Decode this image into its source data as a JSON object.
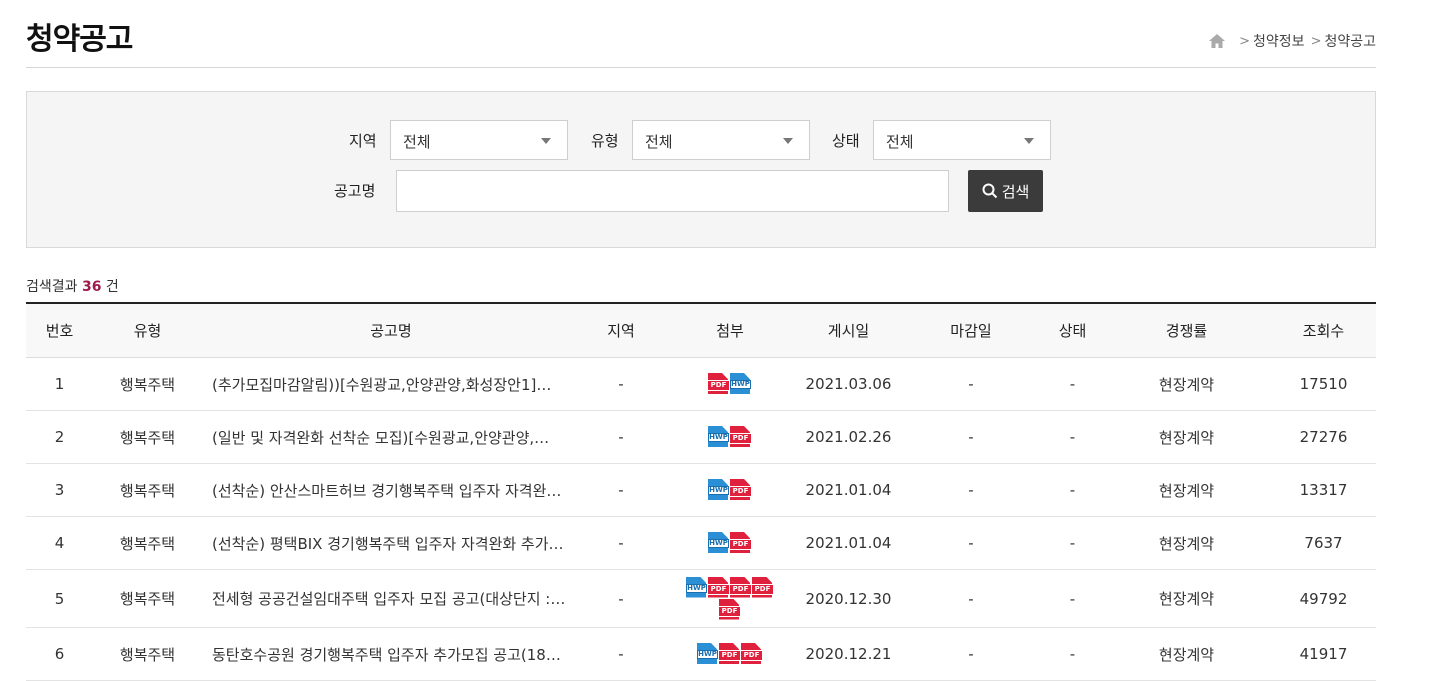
{
  "header": {
    "title": "청약공고",
    "breadcrumb": [
      "청약정보",
      "청약공고"
    ]
  },
  "search": {
    "region_label": "지역",
    "region_value": "전체",
    "type_label": "유형",
    "type_value": "전체",
    "status_label": "상태",
    "status_value": "전체",
    "keyword_label": "공고명",
    "keyword_value": "",
    "button_label": "검색"
  },
  "result": {
    "prefix": "검색결과",
    "count": "36",
    "suffix": "건"
  },
  "table": {
    "headers": [
      "번호",
      "유형",
      "공고명",
      "지역",
      "첨부",
      "게시일",
      "마감일",
      "상태",
      "경쟁률",
      "조회수"
    ],
    "rows": [
      {
        "no": "1",
        "type": "행복주택",
        "title": "(추가모집마감알림))[수원광교,안양관양,화성장안1]…",
        "region": "-",
        "files": [
          "pdf",
          "hwp"
        ],
        "posted": "2021.03.06",
        "deadline": "-",
        "status": "-",
        "rate": "현장계약",
        "views": "17510"
      },
      {
        "no": "2",
        "type": "행복주택",
        "title": "(일반 및 자격완화 선착순 모집)[수원광교,안양관양,…",
        "region": "-",
        "files": [
          "hwp",
          "pdf"
        ],
        "posted": "2021.02.26",
        "deadline": "-",
        "status": "-",
        "rate": "현장계약",
        "views": "27276"
      },
      {
        "no": "3",
        "type": "행복주택",
        "title": "(선착순) 안산스마트허브 경기행복주택 입주자 자격완…",
        "region": "-",
        "files": [
          "hwp",
          "pdf"
        ],
        "posted": "2021.01.04",
        "deadline": "-",
        "status": "-",
        "rate": "현장계약",
        "views": "13317"
      },
      {
        "no": "4",
        "type": "행복주택",
        "title": "(선착순) 평택BIX 경기행복주택 입주자 자격완화 추가…",
        "region": "-",
        "files": [
          "hwp",
          "pdf"
        ],
        "posted": "2021.01.04",
        "deadline": "-",
        "status": "-",
        "rate": "현장계약",
        "views": "7637"
      },
      {
        "no": "5",
        "type": "행복주택",
        "title": "전세형 공공건설임대주택 입주자 모집 공고(대상단지 :…",
        "region": "-",
        "files": [
          "hwp",
          "pdf",
          "pdf",
          "pdf",
          "pdf"
        ],
        "posted": "2020.12.30",
        "deadline": "-",
        "status": "-",
        "rate": "현장계약",
        "views": "49792"
      },
      {
        "no": "6",
        "type": "행복주택",
        "title": "동탄호수공원 경기행복주택 입주자 추가모집 공고(18…",
        "region": "-",
        "files": [
          "hwp",
          "pdf",
          "pdf"
        ],
        "posted": "2020.12.21",
        "deadline": "-",
        "status": "-",
        "rate": "현장계약",
        "views": "41917"
      }
    ]
  }
}
